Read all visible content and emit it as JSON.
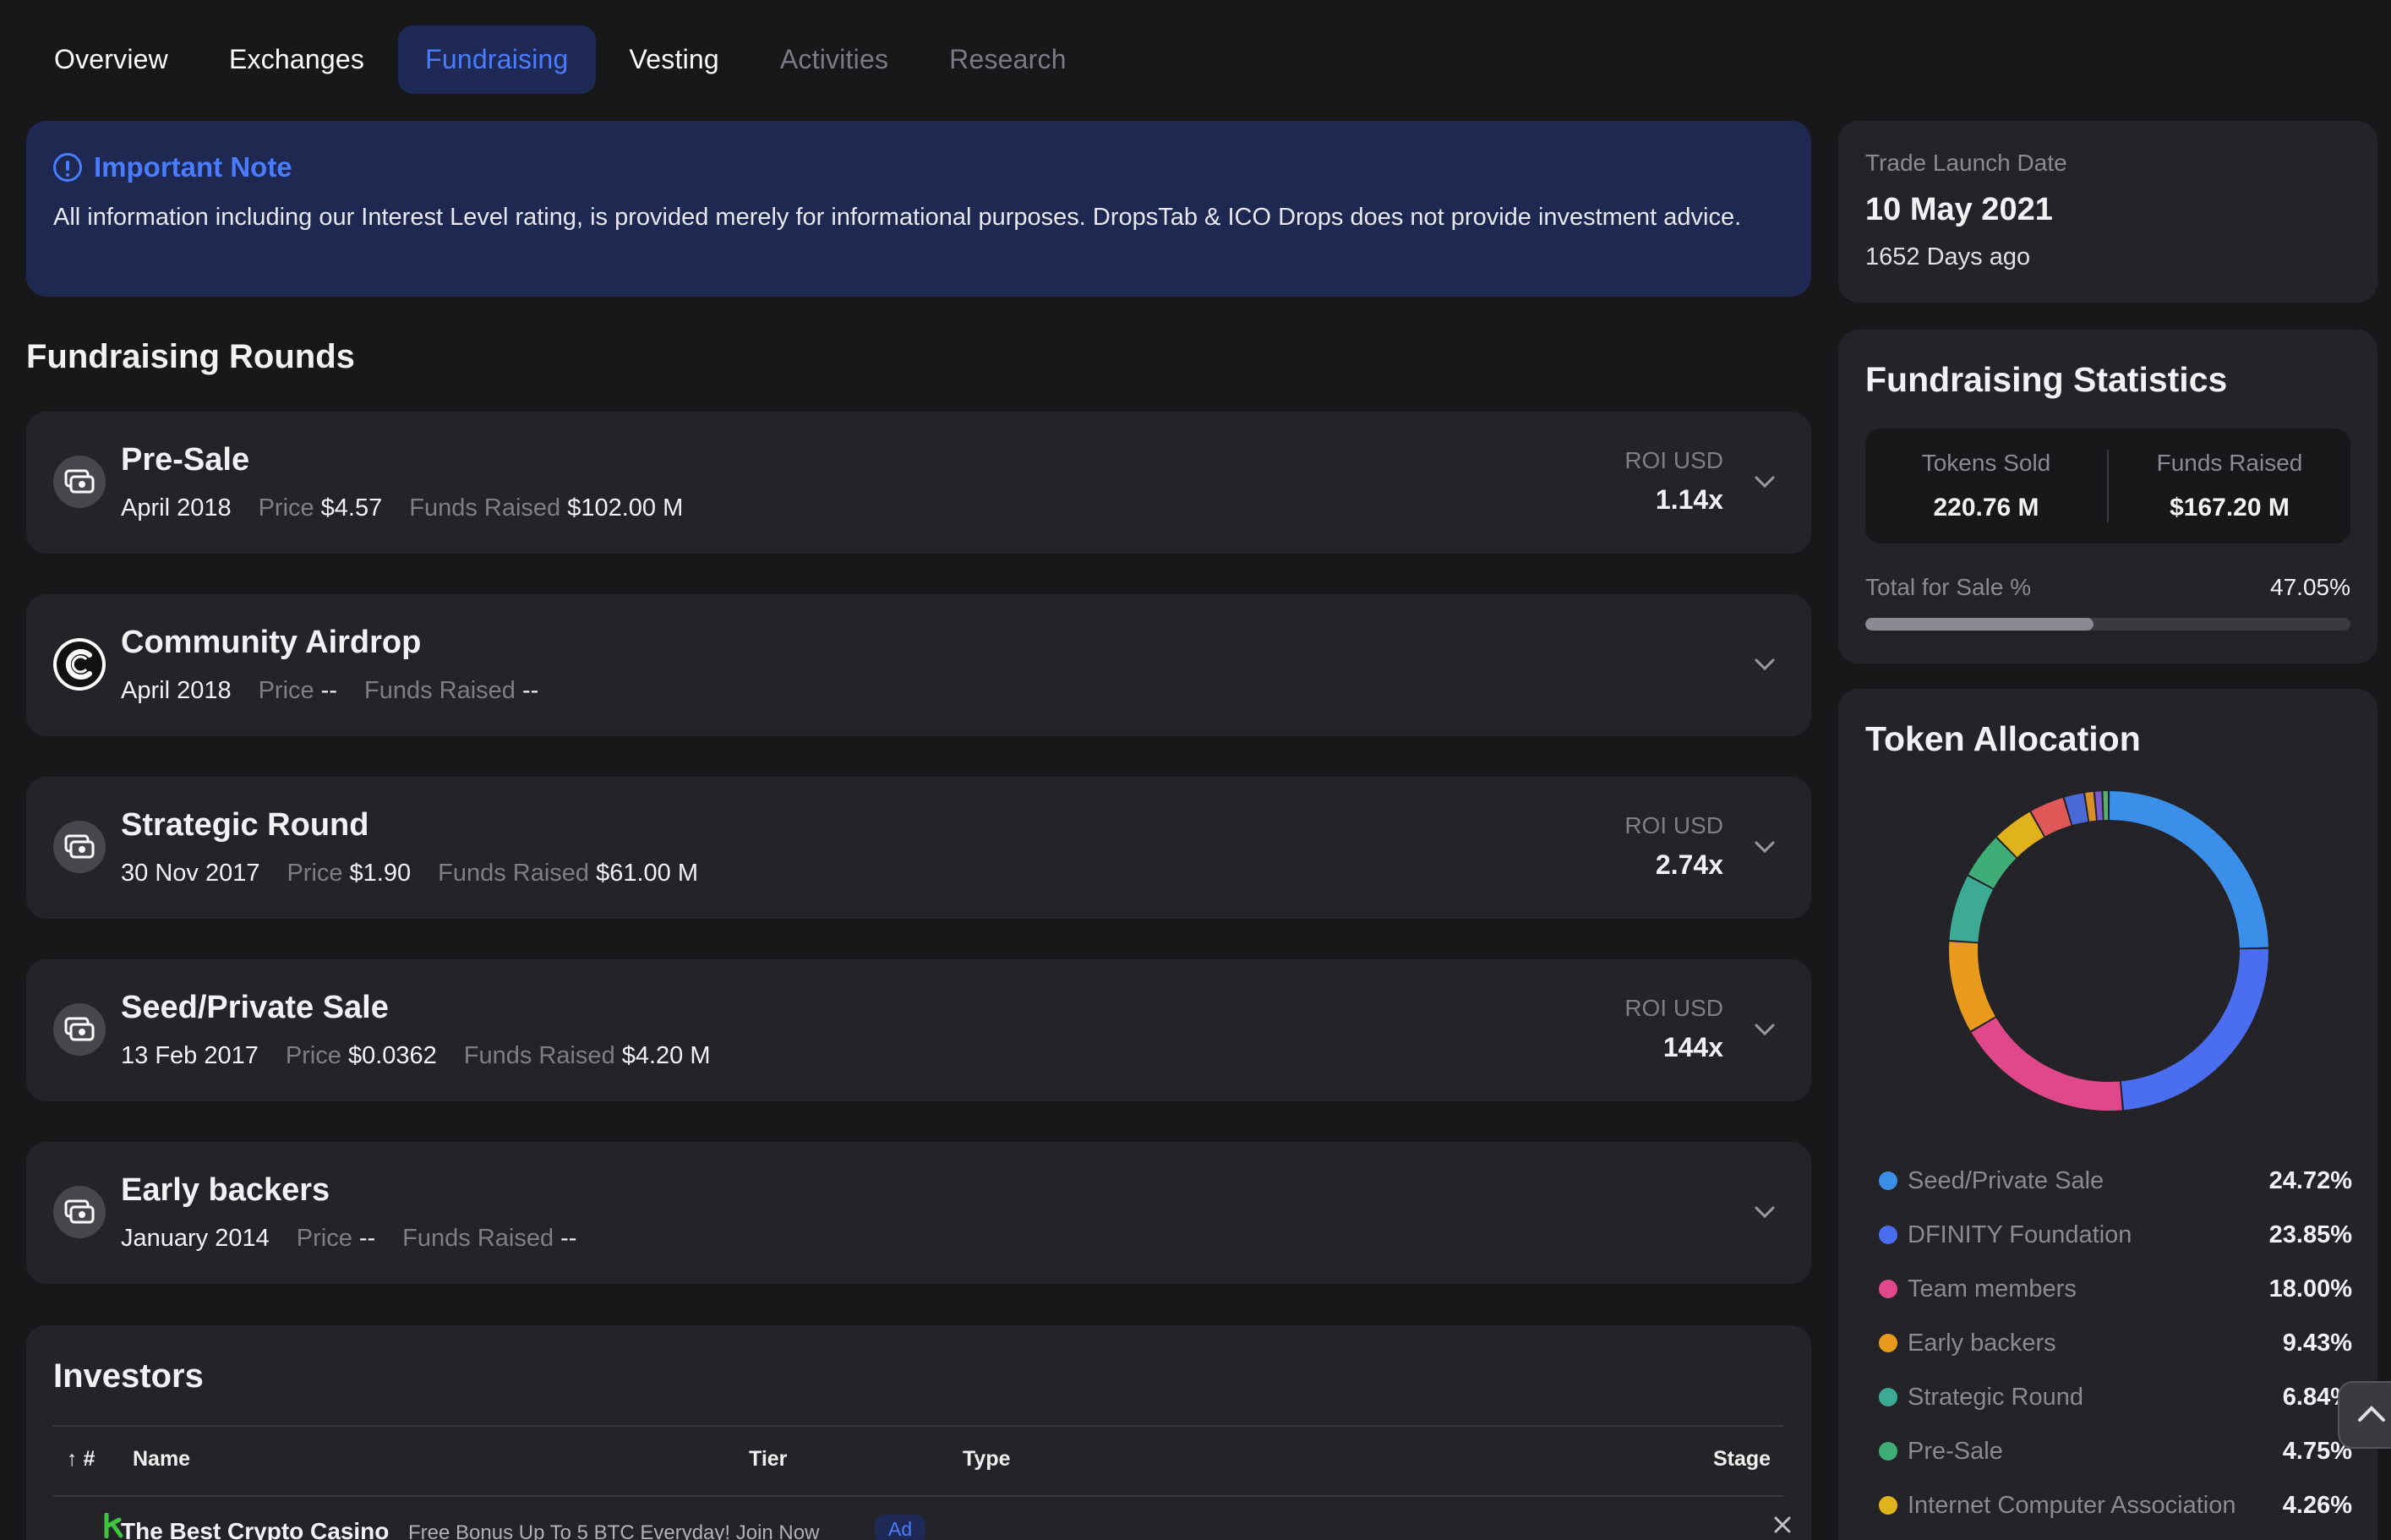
{
  "tabs": [
    {
      "label": "Overview"
    },
    {
      "label": "Exchanges"
    },
    {
      "label": "Fundraising"
    },
    {
      "label": "Vesting"
    },
    {
      "label": "Activities"
    },
    {
      "label": "Research"
    }
  ],
  "note": {
    "title": "Important Note",
    "body": "All information including our Interest Level rating, is provided merely for informational purposes. DropsTab & ICO Drops does not provide investment advice."
  },
  "rounds_title": "Fundraising Rounds",
  "labels": {
    "price": "Price",
    "funds_raised": "Funds Raised",
    "roi": "ROI USD"
  },
  "rounds": [
    {
      "name": "Pre-Sale",
      "date": "April 2018",
      "price": "$4.57",
      "funds": "$102.00 M",
      "roi": "1.14x",
      "icon": "money-icon"
    },
    {
      "name": "Community Airdrop",
      "date": "April 2018",
      "price": "--",
      "funds": "--",
      "roi": "",
      "icon": "airdrop-logo-icon"
    },
    {
      "name": "Strategic Round",
      "date": "30 Nov 2017",
      "price": "$1.90",
      "funds": "$61.00 M",
      "roi": "2.74x",
      "icon": "money-icon"
    },
    {
      "name": "Seed/Private Sale",
      "date": "13 Feb 2017",
      "price": "$0.0362",
      "funds": "$4.20 M",
      "roi": "144x",
      "icon": "money-icon"
    },
    {
      "name": "Early backers",
      "date": "January 2014",
      "price": "--",
      "funds": "--",
      "roi": "",
      "icon": "money-icon"
    }
  ],
  "investors": {
    "title": "Investors",
    "columns": {
      "num": "#",
      "name": "Name",
      "tier": "Tier",
      "type": "Type",
      "stage": "Stage"
    },
    "ad": {
      "name": "The Best Crypto Casino",
      "desc": "Free Bonus Up To 5 BTC Everyday! Join Now",
      "badge": "Ad"
    }
  },
  "launch": {
    "label": "Trade Launch Date",
    "date": "10 May 2021",
    "ago": "1652 Days ago"
  },
  "stats": {
    "title": "Fundraising Statistics",
    "tokens_sold_label": "Tokens Sold",
    "tokens_sold": "220.76 M",
    "funds_raised_label": "Funds Raised",
    "funds_raised": "$167.20 M",
    "sale_label": "Total for Sale %",
    "sale_value": "47.05%",
    "sale_fraction": 0.4705
  },
  "allocation": {
    "title": "Token Allocation",
    "items": [
      {
        "name": "Seed/Private Sale",
        "value": "24.72%",
        "pct": 24.72,
        "color": "#3b8fe8"
      },
      {
        "name": "DFINITY Foundation",
        "value": "23.85%",
        "pct": 23.85,
        "color": "#4b6df0"
      },
      {
        "name": "Team members",
        "value": "18.00%",
        "pct": 18.0,
        "color": "#e0488a"
      },
      {
        "name": "Early backers",
        "value": "9.43%",
        "pct": 9.43,
        "color": "#e89b1c"
      },
      {
        "name": "Strategic Round",
        "value": "6.84%",
        "pct": 6.84,
        "color": "#3daa94"
      },
      {
        "name": "Pre-Sale",
        "value": "4.75%",
        "pct": 4.75,
        "color": "#3fae76"
      },
      {
        "name": "Internet Computer Association",
        "value": "4.26%",
        "pct": 4.26,
        "color": "#e0b21c"
      }
    ],
    "hidden_rest": [
      {
        "pct": 3.6,
        "color": "#e05858"
      },
      {
        "pct": 2.1,
        "color": "#4a6ad8"
      },
      {
        "pct": 1.0,
        "color": "#d9902a"
      },
      {
        "pct": 0.8,
        "color": "#7a5ad0"
      },
      {
        "pct": 0.65,
        "color": "#5ab070"
      }
    ]
  }
}
